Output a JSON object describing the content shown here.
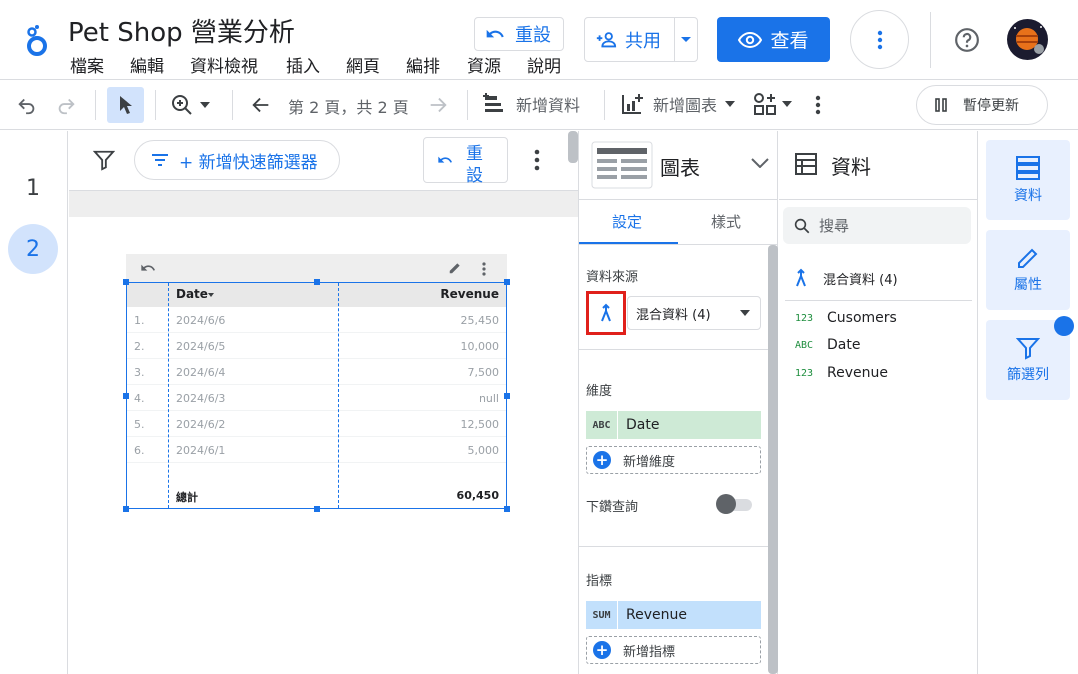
{
  "header": {
    "title": "Pet Shop 營業分析",
    "menu": [
      "檔案",
      "編輯",
      "資料檢視",
      "插入",
      "網頁",
      "編排",
      "資源",
      "說明"
    ],
    "reset_label": "重設",
    "share_label": "共用",
    "view_label": "查看"
  },
  "toolbar": {
    "page_indicator": "第 2 頁，共 2 頁",
    "add_data": "新增資料",
    "add_chart": "新增圖表",
    "pause_update": "暫停更新"
  },
  "pages": {
    "page1": "1",
    "page2": "2"
  },
  "canvas": {
    "add_filter": "+ 新增快速篩選器",
    "reset_line1": "重",
    "reset_line2": "設"
  },
  "table": {
    "columns": [
      "Date",
      "Revenue"
    ],
    "rows": [
      {
        "num": "1.",
        "date": "2024/6/6",
        "revenue": "25,450"
      },
      {
        "num": "2.",
        "date": "2024/6/5",
        "revenue": "10,000"
      },
      {
        "num": "3.",
        "date": "2024/6/4",
        "revenue": "7,500"
      },
      {
        "num": "4.",
        "date": "2024/6/3",
        "revenue": "null"
      },
      {
        "num": "5.",
        "date": "2024/6/2",
        "revenue": "12,500"
      },
      {
        "num": "6.",
        "date": "2024/6/1",
        "revenue": "5,000"
      }
    ],
    "total_label": "總計",
    "total_value": "60,450"
  },
  "setup": {
    "chart_type": "圖表",
    "tab_setup": "設定",
    "tab_style": "樣式",
    "data_source_label": "資料來源",
    "data_source": "混合資料 (4)",
    "dimension_label": "維度",
    "dimension_tag": "ABC",
    "dimension": "Date",
    "add_dimension": "新增維度",
    "drilldown": "下鑽查詢",
    "metric_label": "指標",
    "metric_tag": "SUM",
    "metric": "Revenue",
    "add_metric": "新增指標"
  },
  "data_panel": {
    "title": "資料",
    "search_placeholder": "搜尋",
    "source": "混合資料 (4)",
    "fields": [
      {
        "type": "123",
        "name": "Cusomers"
      },
      {
        "type": "ABC",
        "name": "Date"
      },
      {
        "type": "123",
        "name": "Revenue"
      }
    ]
  },
  "rail": {
    "data": "資料",
    "properties": "屬性",
    "filter": "篩選列"
  },
  "colors": {
    "accent": "#1a73e8",
    "dimension_chip": "#ceead6",
    "metric_chip": "#c2e0fc",
    "highlight": "#e0201b"
  }
}
